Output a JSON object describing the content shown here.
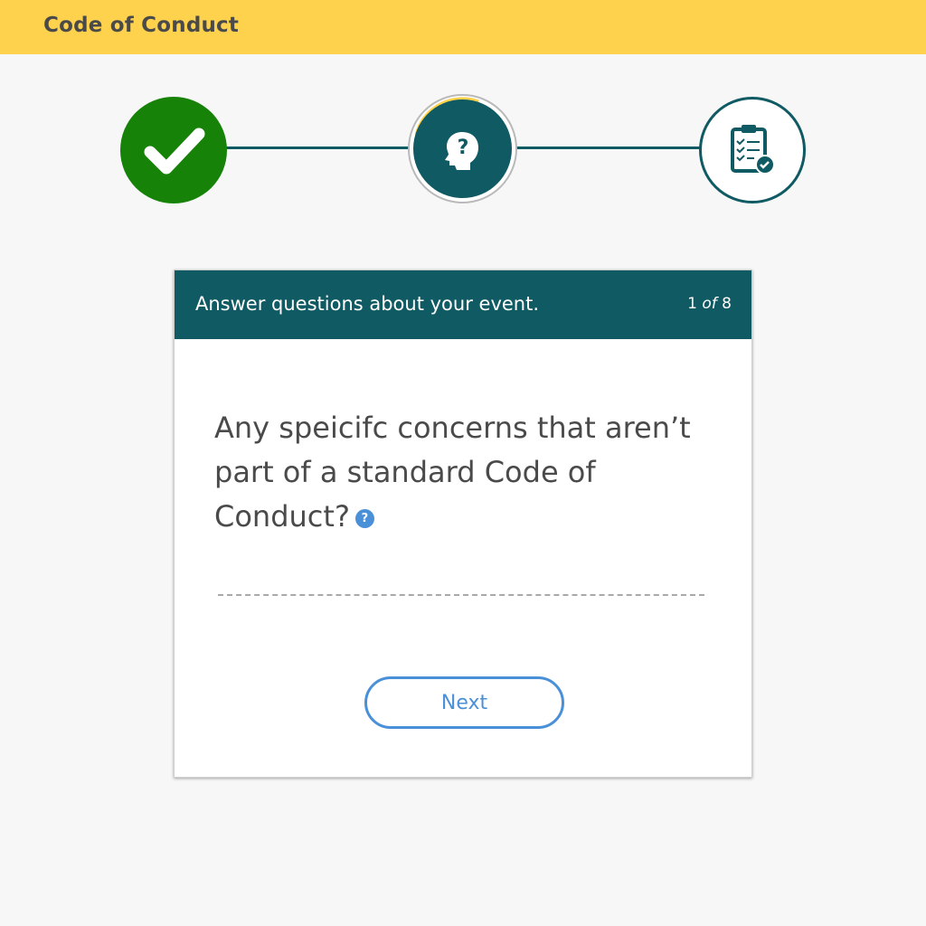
{
  "header": {
    "title": "Code of Conduct",
    "color": "#ffd24d"
  },
  "stepper": {
    "steps": [
      {
        "state": "complete",
        "icon": "checkmark-icon",
        "color": "#168208"
      },
      {
        "state": "current",
        "icon": "head-question-icon",
        "color": "#0f5a63"
      },
      {
        "state": "upcoming",
        "icon": "clipboard-check-icon",
        "color": "#0f5a63"
      }
    ],
    "accent": "#ffd24d"
  },
  "card": {
    "title": "Answer questions about your event.",
    "counter_current": "1",
    "counter_of": "of",
    "counter_total": "8",
    "question": "Any speicifc concerns that aren’t part of a standard Code of Conduct?",
    "help_icon_glyph": "?",
    "answer_value": "",
    "next_label": "Next"
  },
  "colors": {
    "teal": "#0f5a63",
    "link_blue": "#4a90d9",
    "success_green": "#168208"
  }
}
